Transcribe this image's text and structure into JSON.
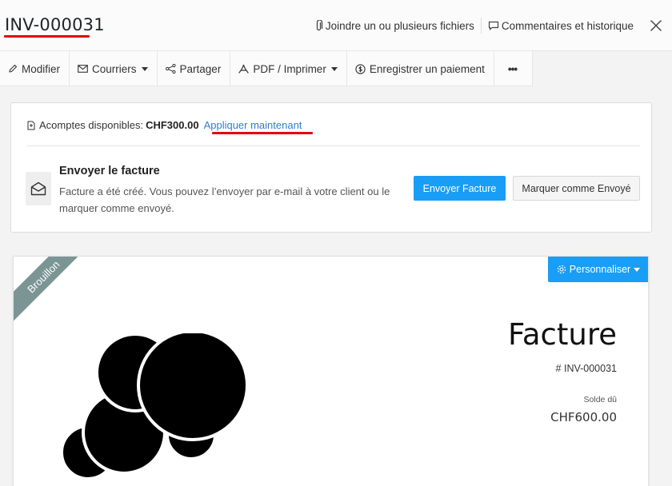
{
  "header": {
    "invoice_id": "INV-000031",
    "attach_label": "Joindre un ou plusieurs fichiers",
    "comments_label": "Commentaires et historique"
  },
  "toolbar": {
    "edit": "Modifier",
    "mail": "Courriers",
    "share": "Partager",
    "pdf": "PDF / Imprimer",
    "payment": "Enregistrer un paiement",
    "more": "•••"
  },
  "credits": {
    "label": "Acomptes disponibles:",
    "amount": "CHF300.00",
    "apply": "Appliquer maintenant"
  },
  "send": {
    "title": "Envoyer le facture",
    "description": "Facture a été créé. Vous pouvez l’envoyer par e-mail à votre client ou le marquer comme envoyé.",
    "send_button": "Envoyer Facture",
    "mark_button": "Marquer comme Envoyé"
  },
  "invoice": {
    "status_ribbon": "Brouillon",
    "customize": "Personnaliser",
    "doc_title": "Facture",
    "number": "# INV-000031",
    "balance_label": "Solde dû",
    "balance_amount": "CHF600.00"
  },
  "colors": {
    "accent": "#1a9df5",
    "link": "#2d7fd3",
    "highlight": "#e3000f",
    "ribbon": "#7b9594"
  }
}
